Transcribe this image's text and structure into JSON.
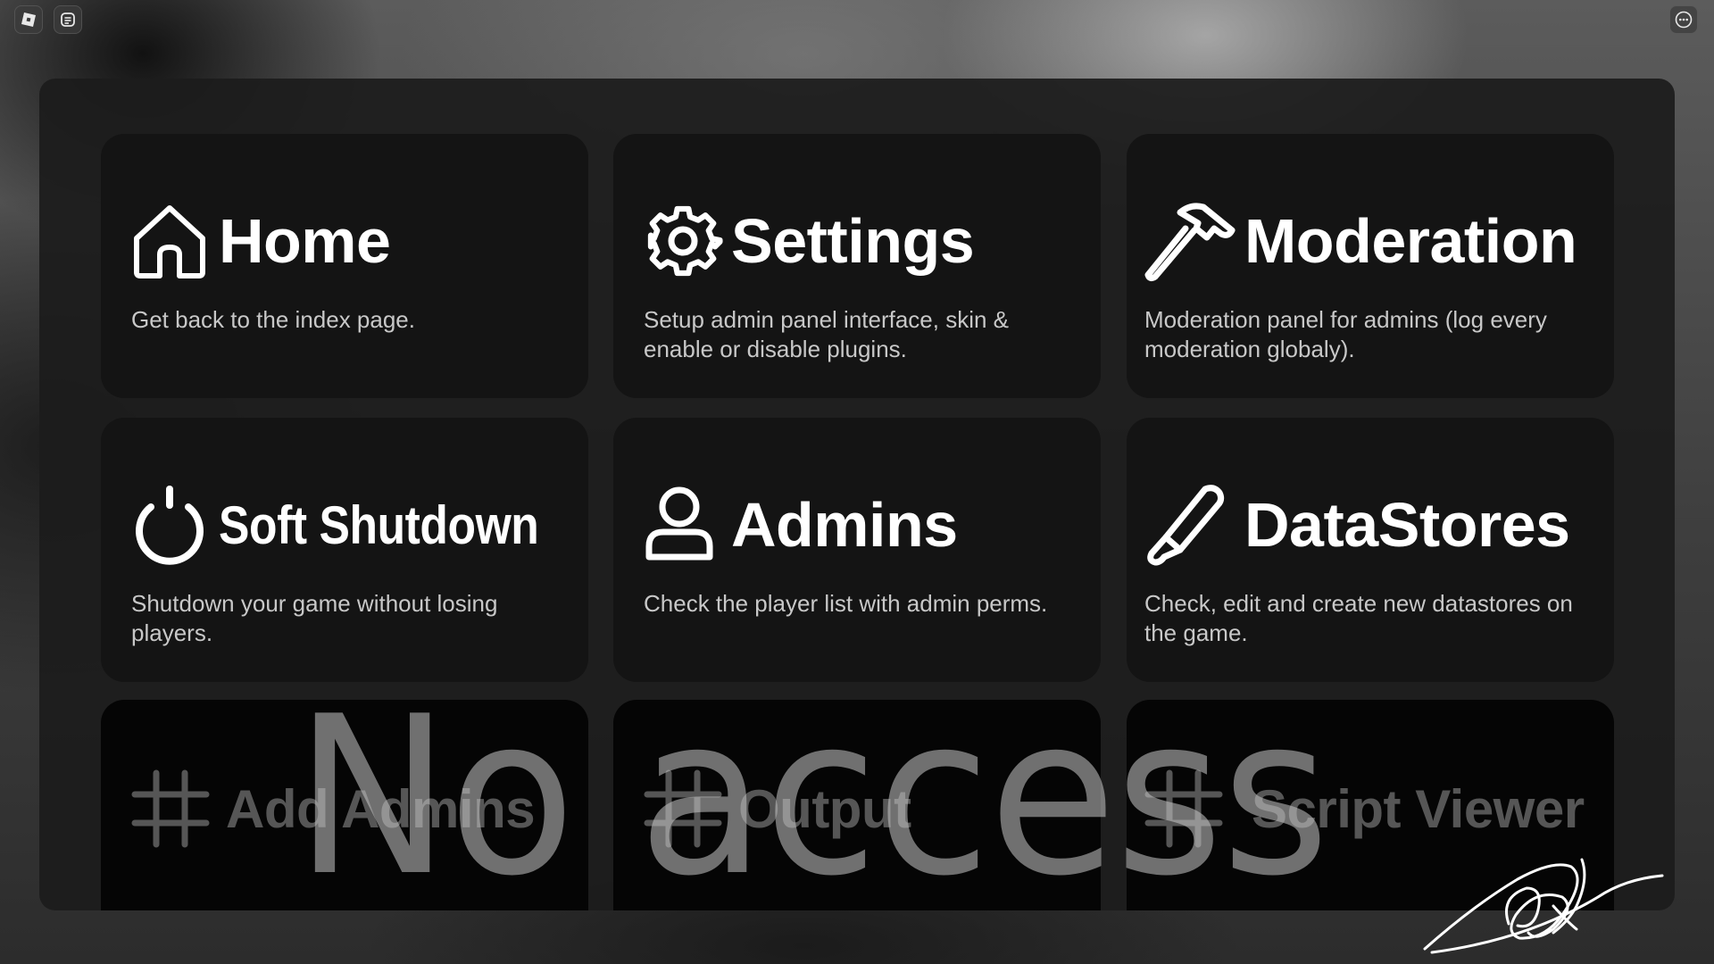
{
  "topbar": {
    "left_icons": [
      "roblox-logo-icon",
      "chat-icon"
    ],
    "right_icons": [
      "more-options-icon"
    ]
  },
  "cards": [
    {
      "title": "Home",
      "description": "Get back to the index page.",
      "icon": "home-icon",
      "locked": false
    },
    {
      "title": "Settings",
      "description": "Setup admin panel interface, skin & enable or disable plugins.",
      "icon": "gear-icon",
      "locked": false
    },
    {
      "title": "Moderation",
      "description": "Moderation panel for admins (log every moderation globaly).",
      "icon": "hammer-icon",
      "locked": false
    },
    {
      "title": "Soft Shutdown",
      "description": "Shutdown your game without losing players.",
      "icon": "power-icon",
      "locked": false
    },
    {
      "title": "Admins",
      "description": "Check the player list with admin perms.",
      "icon": "user-icon",
      "locked": false
    },
    {
      "title": "DataStores",
      "description": "Check, edit and create new datastores on the game.",
      "icon": "brush-icon",
      "locked": false
    },
    {
      "title": "Add Admins",
      "icon": "hashtag-icon",
      "locked": true
    },
    {
      "title": "Output",
      "icon": "hashtag-icon",
      "locked": true
    },
    {
      "title": "Script Viewer",
      "icon": "hashtag-icon",
      "locked": true
    }
  ],
  "overlay": {
    "no_access_text": "No access"
  },
  "colors": {
    "panel": "#1c1c1c",
    "card": "#141414",
    "card_locked": "#050505",
    "text": "#ffffff",
    "desc": "#c8c8c8"
  }
}
